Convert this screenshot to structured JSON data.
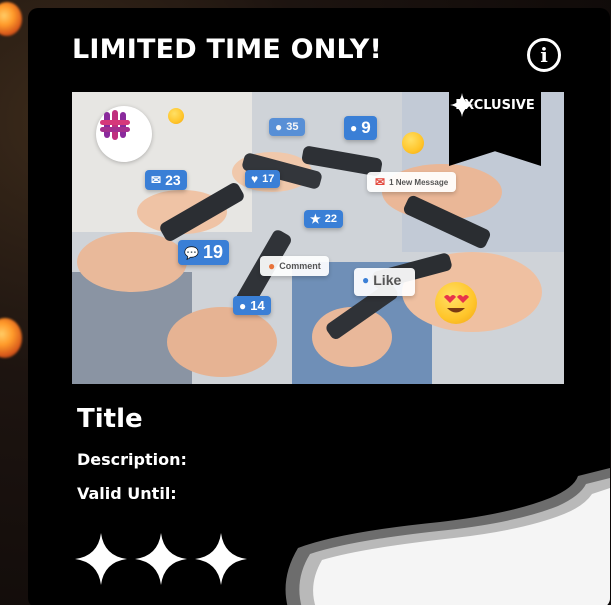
{
  "card": {
    "heading": "LIMITED TIME ONLY!",
    "info_icon": "info-circle-icon",
    "ribbon_label": "EXCLUSIVE",
    "ribbon_icon": "sparkle-star-icon",
    "title": "Title",
    "description_label": "Description:",
    "valid_until_label": "Valid Until:",
    "rating_icons": [
      "sparkle-star-icon",
      "sparkle-star-icon",
      "sparkle-star-icon"
    ],
    "corner_icon": "page-curl-icon"
  },
  "photo": {
    "logo_icon": "brand-logo-icon",
    "chips": [
      {
        "name": "mail-count-chip",
        "icon": "mail-icon",
        "value": "23"
      },
      {
        "name": "heart-count-chip",
        "icon": "heart-icon",
        "value": "17"
      },
      {
        "name": "user-count-chip-top",
        "icon": "user-icon",
        "value": "9"
      },
      {
        "name": "star-count-chip",
        "icon": "star-icon",
        "value": "22"
      },
      {
        "name": "comment-count-chip",
        "icon": "comment-icon",
        "value": "19"
      },
      {
        "name": "user-count-chip-bottom",
        "icon": "user-icon",
        "value": "14"
      },
      {
        "name": "people-count-chip",
        "icon": "people-icon",
        "value": "35"
      }
    ],
    "new_message_label": "1 New Message",
    "comment_label": "Comment",
    "like_label": "Like"
  },
  "colors": {
    "card_bg": "#000000",
    "chip_blue": "#3a7fd6",
    "text": "#ffffff"
  }
}
